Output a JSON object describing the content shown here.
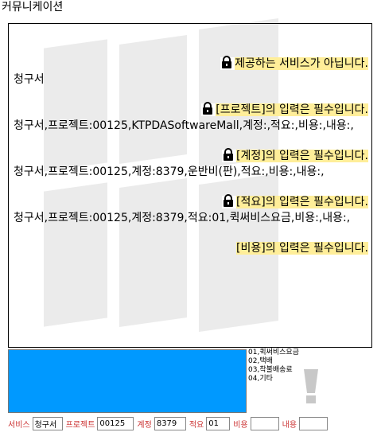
{
  "window": {
    "title": "커뮤니케이션"
  },
  "log": {
    "entries": [
      {
        "type": "alert",
        "text": "제공하는 서비스가 아닙니다."
      },
      {
        "type": "line",
        "text": "청구서"
      },
      {
        "type": "alert",
        "text": "[프로젝트]의 입력은 필수입니다."
      },
      {
        "type": "line",
        "text": "청구서,프로젝트:00125,KTPDASoftwareMall,계정:,적요:,비용:,내용:,"
      },
      {
        "type": "alert",
        "text": "[계정]의 입력은 필수입니다."
      },
      {
        "type": "line",
        "text": "청구서,프로젝트:00125,계정:8379,운반비(판),적요:,비용:,내용:,"
      },
      {
        "type": "alert",
        "text": "[적요]의 입력은 필수입니다."
      },
      {
        "type": "line",
        "text": "청구서,프로젝트:00125,계정:8379,적요:01,퀵써비스요금,비용:,내용:,"
      },
      {
        "type": "alert_plain",
        "text": "[비용]의 입력은 필수입니다."
      }
    ]
  },
  "service_options": [
    "01,퀵써비스요금",
    "02,택배",
    "03,착불배송료",
    "04,기타"
  ],
  "form": {
    "service_label": "서비스",
    "service_value": "청구서",
    "project_label": "프로젝트",
    "project_value": "00125",
    "account_label": "계정",
    "account_value": "8379",
    "memo_label": "적요",
    "memo_value": "01",
    "cost_label": "비용",
    "cost_value": "",
    "content_label": "내용",
    "content_value": ""
  },
  "colors": {
    "highlight": "#ffee99",
    "input_panel": "#0099ff",
    "form_label": "#cc3333"
  },
  "icons": {
    "alert": "lock-icon",
    "warning": "exclamation-icon"
  }
}
